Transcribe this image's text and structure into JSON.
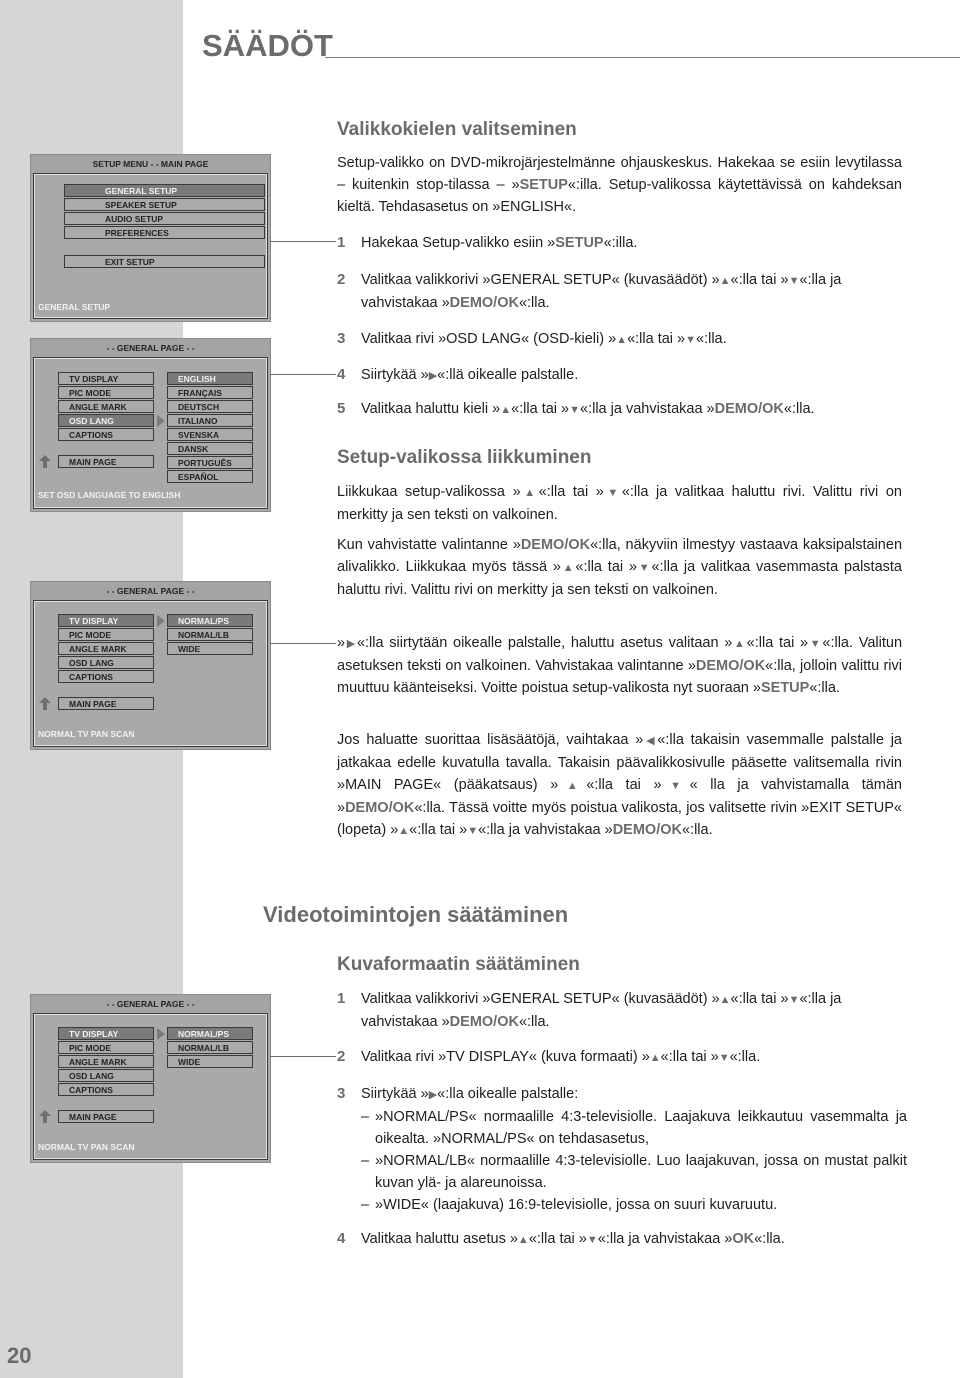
{
  "page": {
    "title": "SÄÄDÖT",
    "page_number": "20"
  },
  "osd_main": {
    "header": "SETUP MENU - - MAIN PAGE",
    "items": [
      "GENERAL SETUP",
      "SPEAKER SETUP",
      "AUDIO SETUP",
      "PREFERENCES"
    ],
    "selected": "GENERAL SETUP",
    "exit": "EXIT SETUP",
    "status": "GENERAL SETUP"
  },
  "osd_lang": {
    "header": "- - GENERAL PAGE - -",
    "left_items": [
      "TV DISPLAY",
      "PIC MODE",
      "ANGLE MARK",
      "OSD LANG",
      "CAPTIONS"
    ],
    "left_selected": "OSD LANG",
    "main_page": "MAIN PAGE",
    "right_items": [
      "ENGLISH",
      "FRANÇAIS",
      "DEUTSCH",
      "ITALIANO",
      "SVENSKA",
      "DANSK",
      "PORTUGUÊS",
      "ESPAÑOL"
    ],
    "right_selected": "ENGLISH",
    "status": "SET OSD LANGUAGE TO ENGLISH"
  },
  "osd_display_1": {
    "header": "- - GENERAL PAGE - -",
    "left_items": [
      "TV DISPLAY",
      "PIC MODE",
      "ANGLE MARK",
      "OSD LANG",
      "CAPTIONS"
    ],
    "left_selected": "TV DISPLAY",
    "main_page": "MAIN PAGE",
    "right_items": [
      "NORMAL/PS",
      "NORMAL/LB",
      "WIDE"
    ],
    "right_selected": "NORMAL/PS",
    "status": "NORMAL TV PAN SCAN"
  },
  "osd_display_2": {
    "header": "- - GENERAL PAGE - -",
    "left_items": [
      "TV DISPLAY",
      "PIC MODE",
      "ANGLE MARK",
      "OSD LANG",
      "CAPTIONS"
    ],
    "left_selected": "TV DISPLAY",
    "main_page": "MAIN PAGE",
    "right_items": [
      "NORMAL/PS",
      "NORMAL/LB",
      "WIDE"
    ],
    "right_selected": "NORMAL/PS",
    "status": "NORMAL TV PAN SCAN"
  },
  "section_lang": {
    "heading": "Valikkokielen valitseminen",
    "intro": [
      {
        "t": "Setup-valikko on DVD-mikrojärjestelmänne ohjauskeskus. Hakekaa se esiin levytilassa – kuitenkin stop-tilassa – »"
      },
      {
        "t": "SETUP",
        "b": true
      },
      {
        "t": "«:illa. Setup-valikossa käytettävissä on kahdeksan kieltä. Tehdasasetus on »ENGLISH«."
      }
    ],
    "steps": [
      {
        "num": "1",
        "parts": [
          {
            "t": "Hakekaa Setup-valikko esiin »"
          },
          {
            "t": "SETUP",
            "b": true
          },
          {
            "t": "«:illa."
          }
        ]
      },
      {
        "num": "2",
        "parts": [
          {
            "t": "Valitkaa valikkorivi »GENERAL SETUP« (kuvasäädöt) »"
          },
          {
            "t": "▲",
            "tri": true
          },
          {
            "t": "«:lla tai »"
          },
          {
            "t": "▼",
            "tri": true
          },
          {
            "t": "«:lla ja vahvistakaa »"
          },
          {
            "t": "DEMO/OK",
            "b": true
          },
          {
            "t": "«:lla."
          }
        ]
      },
      {
        "num": "3",
        "parts": [
          {
            "t": "Valitkaa rivi »OSD LANG« (OSD-kieli) »"
          },
          {
            "t": "▲",
            "tri": true
          },
          {
            "t": "«:lla tai »"
          },
          {
            "t": "▼",
            "tri": true
          },
          {
            "t": "«:lla."
          }
        ]
      },
      {
        "num": "4",
        "parts": [
          {
            "t": "Siirtykää »"
          },
          {
            "t": "▶",
            "tri": true
          },
          {
            "t": "«:llä oikealle palstalle."
          }
        ]
      },
      {
        "num": "5",
        "parts": [
          {
            "t": "Valitkaa haluttu kieli »"
          },
          {
            "t": "▲",
            "tri": true
          },
          {
            "t": "«:lla tai »"
          },
          {
            "t": "▼",
            "tri": true
          },
          {
            "t": "«:lla ja vahvistakaa »"
          },
          {
            "t": "DEMO/OK",
            "b": true
          },
          {
            "t": "«:lla."
          }
        ]
      }
    ]
  },
  "section_nav": {
    "heading": "Setup-valikossa liikkuminen",
    "paragraphs": [
      [
        {
          "t": "Liikkukaa setup-valikossa »"
        },
        {
          "t": "▲",
          "tri": true
        },
        {
          "t": "«:lla tai »"
        },
        {
          "t": "▼",
          "tri": true
        },
        {
          "t": "«:lla ja valitkaa haluttu rivi. Valittu rivi on merkitty ja sen teksti on valkoinen."
        }
      ],
      [
        {
          "t": "Kun vahvistatte valintanne »"
        },
        {
          "t": "DEMO/OK",
          "b": true
        },
        {
          "t": "«:lla, näkyviin ilmestyy vastaava kaksipalstainen alivalikko. Liikkukaa myös tässä »"
        },
        {
          "t": "▲",
          "tri": true
        },
        {
          "t": "«:lla tai »"
        },
        {
          "t": "▼",
          "tri": true
        },
        {
          "t": "«:lla ja valitkaa vasemmasta palstasta haluttu rivi. Valittu rivi on merkitty ja sen teksti on valkoinen."
        }
      ],
      [
        {
          "t": "»"
        },
        {
          "t": "▶",
          "tri": true
        },
        {
          "t": "«:lla siirtytään oikealle palstalle, haluttu asetus valitaan »"
        },
        {
          "t": "▲",
          "tri": true
        },
        {
          "t": "«:lla tai »"
        },
        {
          "t": "▼",
          "tri": true
        },
        {
          "t": "«:lla. Valitun asetuksen teksti on valkoinen. Vahvistakaa valintanne »"
        },
        {
          "t": "DEMO/OK",
          "b": true
        },
        {
          "t": "«:lla, jolloin valittu rivi muuttuu käänteiseksi. Voitte poistua setup-valikosta nyt suoraan »"
        },
        {
          "t": "SETUP",
          "b": true
        },
        {
          "t": "«:lla."
        }
      ],
      [
        {
          "t": "Jos haluatte suorittaa lisäsäätöjä, vaihtakaa »"
        },
        {
          "t": "◀",
          "tri": true
        },
        {
          "t": "«:lla takaisin vasemmalle palstalle ja jatkakaa edelle kuvatulla tavalla. Takaisin päävalikkosivulle pääsette valitsemalla rivin »MAIN PAGE« (pääkatsaus) »"
        },
        {
          "t": "▲",
          "tri": true
        },
        {
          "t": "«:lla tai »"
        },
        {
          "t": "▼",
          "tri": true
        },
        {
          "t": "« lla ja vahvistamalla tämän »"
        },
        {
          "t": "DEMO/OK",
          "b": true
        },
        {
          "t": "«:lla. Tässä voitte myös poistua valikosta, jos valitsette rivin »EXIT SETUP« (lopeta) »"
        },
        {
          "t": "▲",
          "tri": true
        },
        {
          "t": "«:lla tai »"
        },
        {
          "t": "▼",
          "tri": true
        },
        {
          "t": "«:lla ja vahvistakaa »"
        },
        {
          "t": "DEMO/OK",
          "b": true
        },
        {
          "t": "«:lla."
        }
      ]
    ]
  },
  "section_video": {
    "heading": "Videotoimintojen säätäminen",
    "subheading": "Kuvaformaatin säätäminen",
    "steps": [
      {
        "num": "1",
        "parts": [
          {
            "t": "Valitkaa valikkorivi »GENERAL SETUP« (kuvasäädöt) »"
          },
          {
            "t": "▲",
            "tri": true
          },
          {
            "t": "«:lla tai »"
          },
          {
            "t": "▼",
            "tri": true
          },
          {
            "t": "«:lla ja vahvistakaa »"
          },
          {
            "t": "DEMO/OK",
            "b": true
          },
          {
            "t": "«:lla."
          }
        ]
      },
      {
        "num": "2",
        "parts": [
          {
            "t": "Valitkaa rivi »TV DISPLAY« (kuva formaati) »"
          },
          {
            "t": "▲",
            "tri": true
          },
          {
            "t": "«:lla tai »"
          },
          {
            "t": "▼",
            "tri": true
          },
          {
            "t": "«:lla."
          }
        ]
      },
      {
        "num": "3",
        "parts": [
          {
            "t": "Siirtykää »"
          },
          {
            "t": "▶",
            "tri": true
          },
          {
            "t": "«:lla oikealle palstalle:"
          }
        ],
        "options": [
          "»NORMAL/PS« normaalille 4:3-televisiolle. Laajakuva leikkautuu vasemmalta ja oikealta. »NORMAL/PS« on tehdasasetus,",
          "»NORMAL/LB« normaalille 4:3-televisiolle. Luo laajakuvan, jossa on mustat palkit kuvan ylä- ja alareunoissa.",
          "»WIDE« (laajakuva) 16:9-televisiolle, jossa on suuri kuvaruutu."
        ]
      },
      {
        "num": "4",
        "parts": [
          {
            "t": "Valitkaa haluttu asetus »"
          },
          {
            "t": "▲",
            "tri": true
          },
          {
            "t": "«:lla tai »"
          },
          {
            "t": "▼",
            "tri": true
          },
          {
            "t": "«:lla ja vahvistakaa »"
          },
          {
            "t": "OK",
            "b": true
          },
          {
            "t": "«:lla."
          }
        ]
      }
    ]
  }
}
